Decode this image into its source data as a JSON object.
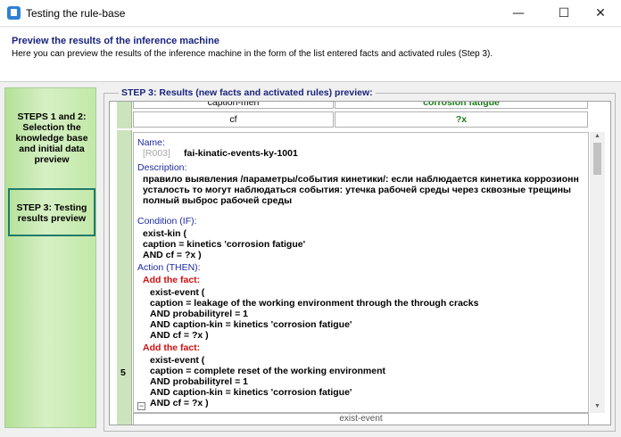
{
  "window": {
    "title": "Testing the rule-base",
    "min_symbol": "—",
    "max_symbol": "☐",
    "close_symbol": "✕"
  },
  "header": {
    "title": "Preview the results of the inference machine",
    "description": "Here you can preview the results of the inference machine in the form of the list entered facts and activated rules (Step 3)."
  },
  "steps": {
    "step1": "STEPS 1 and 2: Selection the knowledge base and initial data preview",
    "step3": "STEP 3: Testing results preview"
  },
  "group_title": "STEP 3: Results (new facts and activated rules) preview:",
  "table": {
    "top_row": {
      "left": "caption-men",
      "right": "corrosion fatigue"
    },
    "cf_row": {
      "left": "cf",
      "right": "?x"
    },
    "row_number": "5",
    "next_row_label": "exist-event"
  },
  "rule": {
    "name_label": "Name:",
    "code": "[R003]",
    "name": "fai-kinatic-events-ky-1001",
    "description_label": "Description:",
    "description_lines": [
      "правило выявления /параметры/события кинетики/: если наблюдается кинетика коррозионн",
      "усталость то могут наблюдаться события: утечка рабочей среды через сквозные трещины",
      "полный выброс рабочей среды"
    ],
    "condition_label": "Condition (IF):",
    "condition_lines": [
      "exist-kin (",
      "caption = kinetics 'corrosion fatigue'",
      "AND cf = ?x )"
    ],
    "action_label": "Action (THEN):",
    "add_fact_label": "Add the fact:",
    "fact1_lines": [
      "exist-event (",
      "caption = leakage of the working environment through the through cracks",
      "AND probabilityrel = 1",
      "AND caption-kin = kinetics 'corrosion fatigue'",
      "AND cf = ?x )"
    ],
    "add_fact_label_2": "Add the fact:",
    "fact2_lines": [
      "exist-event (",
      "caption = complete reset of the working environment",
      "AND probabilityrel = 1",
      "AND caption-kin = kinetics 'corrosion fatigue'",
      "AND cf = ?x )"
    ]
  },
  "icons": {
    "app": "app-icon",
    "scroll_up": "▲",
    "scroll_down": "▼",
    "collapse": "−"
  }
}
